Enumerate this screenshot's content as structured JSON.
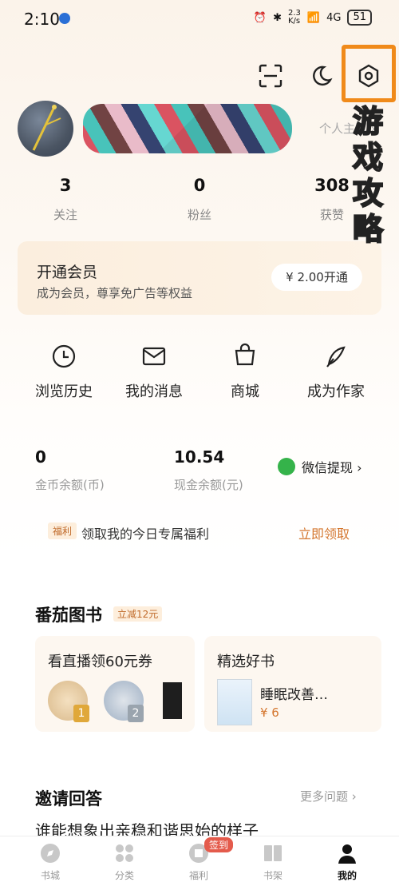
{
  "status_bar": {
    "time": "2:10",
    "net_speed": "2.3\nK/s",
    "signal": "4G",
    "battery": "51"
  },
  "profile": {
    "homepage_link": "个人主页 ›"
  },
  "stats": [
    {
      "value": "3",
      "label": "关注"
    },
    {
      "value": "0",
      "label": "粉丝"
    },
    {
      "value": "308",
      "label": "获赞"
    }
  ],
  "vip": {
    "title": "开通会员",
    "subtitle": "成为会员，尊享免广告等权益",
    "button": "¥ 2.00开通"
  },
  "shortcuts": [
    {
      "label": "浏览历史",
      "icon": "clock-icon"
    },
    {
      "label": "我的消息",
      "icon": "mail-icon"
    },
    {
      "label": "商城",
      "icon": "shopping-bag-icon"
    },
    {
      "label": "成为作家",
      "icon": "feather-pen-icon"
    }
  ],
  "wallet": {
    "coins": {
      "value": "0",
      "label": "金币余额(币)"
    },
    "cash": {
      "value": "10.54",
      "label": "现金余额(元)"
    },
    "withdraw": "微信提现 ›"
  },
  "benefit": {
    "tag": "福利",
    "text": "领取我的今日专属福利",
    "link": "立即领取"
  },
  "fanqie_books": {
    "title": "番茄图书",
    "discount": "立减12元",
    "left_card_title": "看直播领60元券",
    "right_card_title": "精选好书",
    "book_name": "睡眠改善…",
    "book_price": "¥ 6",
    "ranks": [
      "1",
      "2"
    ]
  },
  "invite": {
    "title": "邀请回答",
    "more": "更多问题 ›",
    "question_partial": "谁能想象出亲稳和谐思始的样子"
  },
  "bottom_nav": [
    {
      "label": "书城",
      "icon": "compass-icon"
    },
    {
      "label": "分类",
      "icon": "grid-icon"
    },
    {
      "label": "福利",
      "icon": "gift-icon",
      "badge": "签到"
    },
    {
      "label": "书架",
      "icon": "bookshelf-icon"
    },
    {
      "label": "我的",
      "icon": "person-icon",
      "active": true
    }
  ],
  "watermark": "游戏攻略",
  "colors": {
    "accent_orange": "#d4762e",
    "highlight_box": "#f08a1a",
    "wechat_green": "#35b34a",
    "badge_red": "#e45b4c"
  }
}
